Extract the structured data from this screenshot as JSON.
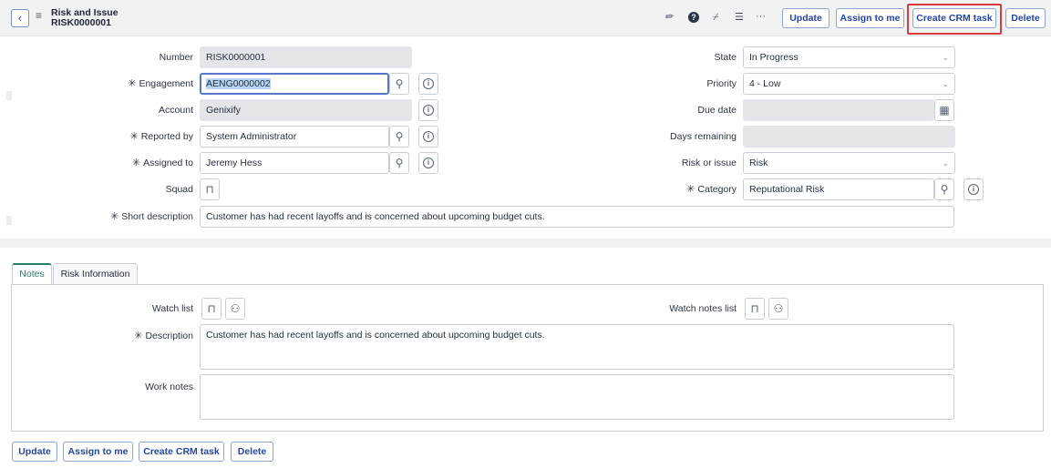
{
  "header": {
    "title": "Risk and Issue",
    "number": "RISK0000001",
    "icons": [
      "paperclip-icon",
      "help-icon",
      "activity-icon",
      "settings-icon",
      "more-icon"
    ],
    "buttons": {
      "update": "Update",
      "assign_to_me": "Assign to me",
      "create_crm_task": "Create CRM task",
      "delete": "Delete"
    }
  },
  "form": {
    "number": {
      "label": "Number",
      "value": "RISK0000001"
    },
    "engagement": {
      "label": "Engagement",
      "value": "AENG0000002",
      "required": true
    },
    "account": {
      "label": "Account",
      "value": "Genixify"
    },
    "reported_by": {
      "label": "Reported by",
      "value": "System Administrator",
      "required": true
    },
    "assigned_to": {
      "label": "Assigned to",
      "value": "Jeremy Hess",
      "required": true
    },
    "squad": {
      "label": "Squad"
    },
    "short_description": {
      "label": "Short description",
      "value": "Customer has had recent layoffs and is concerned about upcoming budget cuts.",
      "required": true
    },
    "state": {
      "label": "State",
      "value": "In Progress"
    },
    "priority": {
      "label": "Priority",
      "value": "4 - Low"
    },
    "due_date": {
      "label": "Due date",
      "value": ""
    },
    "days_remaining": {
      "label": "Days remaining",
      "value": ""
    },
    "risk_or_issue": {
      "label": "Risk or issue",
      "value": "Risk"
    },
    "category": {
      "label": "Category",
      "value": "Reputational Risk",
      "required": true
    }
  },
  "tabs": [
    {
      "label": "Notes",
      "active": true
    },
    {
      "label": "Risk Information",
      "active": false
    }
  ],
  "notes": {
    "watch_list": {
      "label": "Watch list"
    },
    "watch_notes_list": {
      "label": "Watch notes list"
    },
    "description": {
      "label": "Description",
      "value": "Customer has had recent layoffs and is concerned about upcoming budget cuts.",
      "required": true
    },
    "work_notes": {
      "label": "Work notes",
      "value": ""
    }
  },
  "footer": {
    "buttons": {
      "update": "Update",
      "assign_to_me": "Assign to me",
      "create_crm_task": "Create CRM task",
      "delete": "Delete"
    }
  },
  "glyphs": {
    "required": "✳",
    "search": "⚲",
    "info": "i",
    "lock": "🔒",
    "calendar": "▦",
    "chevron": "⌄"
  },
  "colors": {
    "accent": "#2446a5",
    "highlight": "#d83d3d",
    "active_tab": "#2a7a6e"
  }
}
